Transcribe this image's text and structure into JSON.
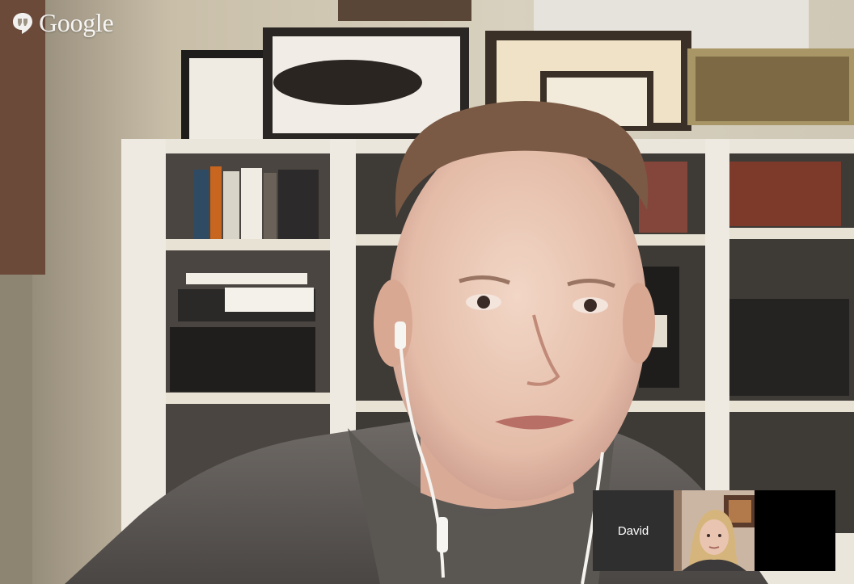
{
  "app": {
    "brand": "Google",
    "logo_icon": "hangouts-quote-icon",
    "accent_color": "#ffffff"
  },
  "main_video": {
    "participant_view": "speaker-video",
    "background_color": "#2a2724"
  },
  "filmstrip": {
    "participants": [
      {
        "name": "David",
        "tile_color": "#2f2f2f"
      },
      {
        "name": "",
        "tile_color": "self-camera"
      },
      {
        "name": "",
        "tile_color": "#000000"
      }
    ]
  }
}
